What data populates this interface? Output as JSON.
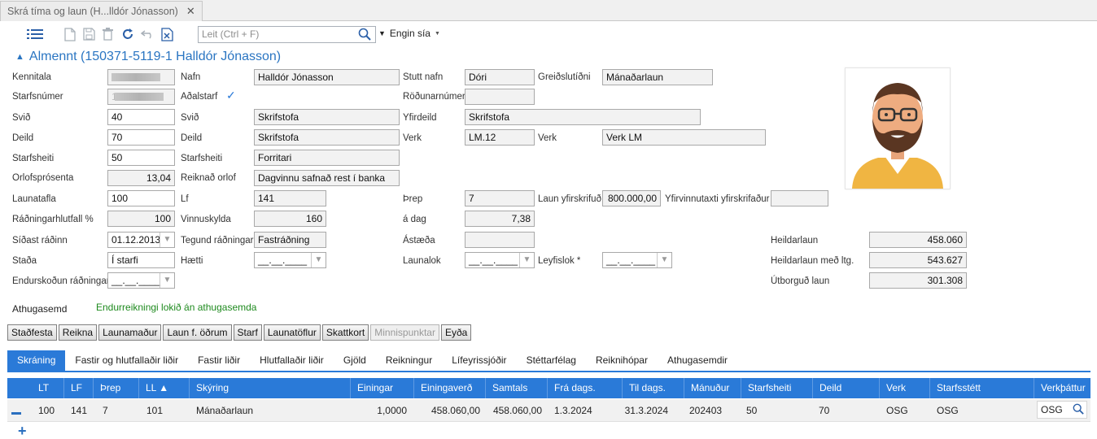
{
  "window": {
    "tab_title": "Skrá tíma og laun (H...lldór Jónasson)",
    "tab_close": "✕"
  },
  "toolbar": {
    "search_placeholder": "Leit (Ctrl + F)",
    "filter_label": "Engin sía"
  },
  "section": {
    "title": "Almennt (150371-5119-1 Halldór Jónasson)"
  },
  "form": {
    "kennitala": {
      "label": "Kennitala"
    },
    "nafn": {
      "label": "Nafn",
      "value": "Halldór Jónasson"
    },
    "stutt_nafn": {
      "label": "Stutt nafn",
      "value": "Dóri"
    },
    "greidslutidni": {
      "label": "Greiðslutíðni",
      "value": "Mánaðarlaun"
    },
    "starfsnumer": {
      "label": "Starfsnúmer",
      "value": "1"
    },
    "adalstarf": {
      "label": "Aðalstarf",
      "checked": "✓"
    },
    "rodunarnumer": {
      "label": "Röðunarnúmer",
      "value": ""
    },
    "svid_code": {
      "label": "Svið",
      "value": "40"
    },
    "svid_name": {
      "label": "Svið",
      "value": "Skrifstofa"
    },
    "yfirdeild": {
      "label": "Yfirdeild",
      "value": "Skrifstofa"
    },
    "deild_code": {
      "label": "Deild",
      "value": "70"
    },
    "deild_name": {
      "label": "Deild",
      "value": "Skrifstofa"
    },
    "verk_code": {
      "label": "Verk",
      "value": "LM.12"
    },
    "verk_name": {
      "label": "Verk",
      "value": "Verk LM"
    },
    "starfsheiti_code": {
      "label": "Starfsheiti",
      "value": "50"
    },
    "starfsheiti_name": {
      "label": "Starfsheiti",
      "value": "Forritari"
    },
    "orlofsprosenta": {
      "label": "Orlofsprósenta",
      "value": "13,04"
    },
    "reiknad_orlof": {
      "label": "Reiknað orlof",
      "value": "Dagvinnu safnað rest í banka"
    },
    "launatafla": {
      "label": "Launatafla",
      "value": "100"
    },
    "lf": {
      "label": "Lf",
      "value": "141"
    },
    "threp": {
      "label": "Þrep",
      "value": "7"
    },
    "laun_yfirskrifud": {
      "label": "Laun yfirskrifuð",
      "value": "800.000,00"
    },
    "yfirvinnutaxti": {
      "label": "Yfirvinnutaxti yfirskrifaður",
      "value": ""
    },
    "radningarhlutfall": {
      "label": "Ráðningarhlutfall %",
      "value": "100"
    },
    "vinnuskylda": {
      "label": "Vinnuskylda",
      "value": "160"
    },
    "a_dag": {
      "label": "á dag",
      "value": "7,38"
    },
    "sidast_radinn": {
      "label": "Síðast ráðinn",
      "value": "01.12.2013"
    },
    "tegund_radningar": {
      "label": "Tegund ráðningar",
      "value": "Fastráðning"
    },
    "astaeda": {
      "label": "Ástæða",
      "value": ""
    },
    "stada": {
      "label": "Staða",
      "value": "Í starfi"
    },
    "haetti": {
      "label": "Hætti",
      "value": "__.__.____"
    },
    "launalok": {
      "label": "Launalok",
      "value": "__.__.____"
    },
    "leyfislok": {
      "label": "Leyfislok *",
      "value": "__.__.____"
    },
    "endurskodun": {
      "label": "Endurskoðun ráðningar",
      "value": "__.__.____"
    },
    "heildarlaun": {
      "label": "Heildarlaun",
      "value": "458.060"
    },
    "heildarlaun_ltg": {
      "label": "Heildarlaun með ltg.",
      "value": "543.627"
    },
    "utborgud": {
      "label": "Útborguð laun",
      "value": "301.308"
    }
  },
  "note": {
    "label": "Athugasemd",
    "text": "Endurreikningi lokið án athugasemda"
  },
  "buttons": [
    "Staðfesta",
    "Reikna",
    "Launamaður",
    "Laun f. öðrum",
    "Starf",
    "Launatöflur",
    "Skattkort",
    "Minnispunktar",
    "Eyða"
  ],
  "tabs": [
    "Skráning",
    "Fastir og hlutfallaðir liðir",
    "Fastir liðir",
    "Hlutfallaðir liðir",
    "Gjöld",
    "Reikningur",
    "Lífeyrissjóðir",
    "Stéttarfélag",
    "Reiknihópar",
    "Athugasemdir"
  ],
  "grid": {
    "columns": [
      "LT",
      "LF",
      "Þrep",
      "LL ▲",
      "Skýring",
      "Einingar",
      "Einingaverð",
      "Samtals",
      "Frá dags.",
      "Til dags.",
      "Mánuður",
      "Starfsheiti",
      "Deild",
      "Verk",
      "Starfsstétt",
      "Verkþáttur"
    ],
    "row": [
      "100",
      "141",
      "7",
      "101",
      "Mánaðarlaun",
      "1,0000",
      "458.060,00",
      "458.060,00",
      "1.3.2024",
      "31.3.2024",
      "202403",
      "50",
      "70",
      "OSG",
      "OSG",
      "OSG"
    ]
  },
  "colors": {
    "accent": "#2a7ad8",
    "title": "#2a75c2",
    "note": "#1e8a1e"
  }
}
